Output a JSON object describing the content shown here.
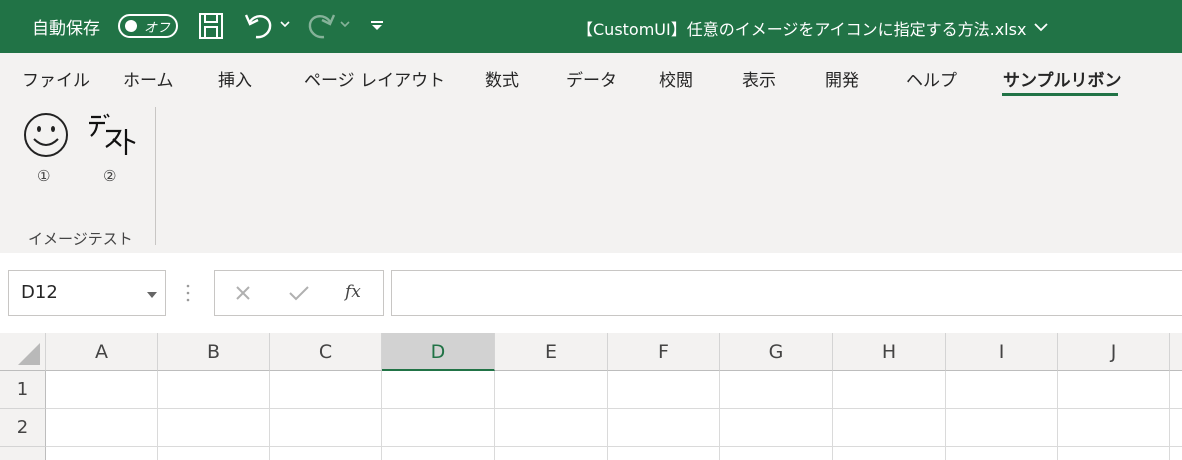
{
  "titlebar": {
    "autosave_label": "自動保存",
    "autosave_state": "オフ",
    "filename": "【CustomUI】任意のイメージをアイコンに指定する方法.xlsx",
    "icons": [
      "save-icon",
      "undo-icon",
      "redo-icon",
      "customize-qat-icon",
      "chevron-down-icon"
    ]
  },
  "ribbon": {
    "tabs": [
      "ファイル",
      "ホーム",
      "挿入",
      "ページ レイアウト",
      "数式",
      "データ",
      "校閲",
      "表示",
      "開発",
      "ヘルプ",
      "サンプルリボン"
    ],
    "active_tab": "サンプルリボン",
    "group": {
      "label": "イメージテスト",
      "buttons": [
        {
          "label": "①",
          "icon": "smiley-icon"
        },
        {
          "label": "②",
          "icon": "text-image-icon",
          "image_text": "テスト"
        }
      ]
    }
  },
  "formula_bar": {
    "name_box": "D12",
    "fx_label": "fx",
    "formula": ""
  },
  "grid": {
    "columns": [
      "A",
      "B",
      "C",
      "D",
      "E",
      "F",
      "G",
      "H",
      "I",
      "J"
    ],
    "selected_column": "D",
    "rows": [
      "1",
      "2"
    ]
  },
  "colors": {
    "accent": "#217346",
    "ribbon_bg": "#f3f2f1"
  }
}
